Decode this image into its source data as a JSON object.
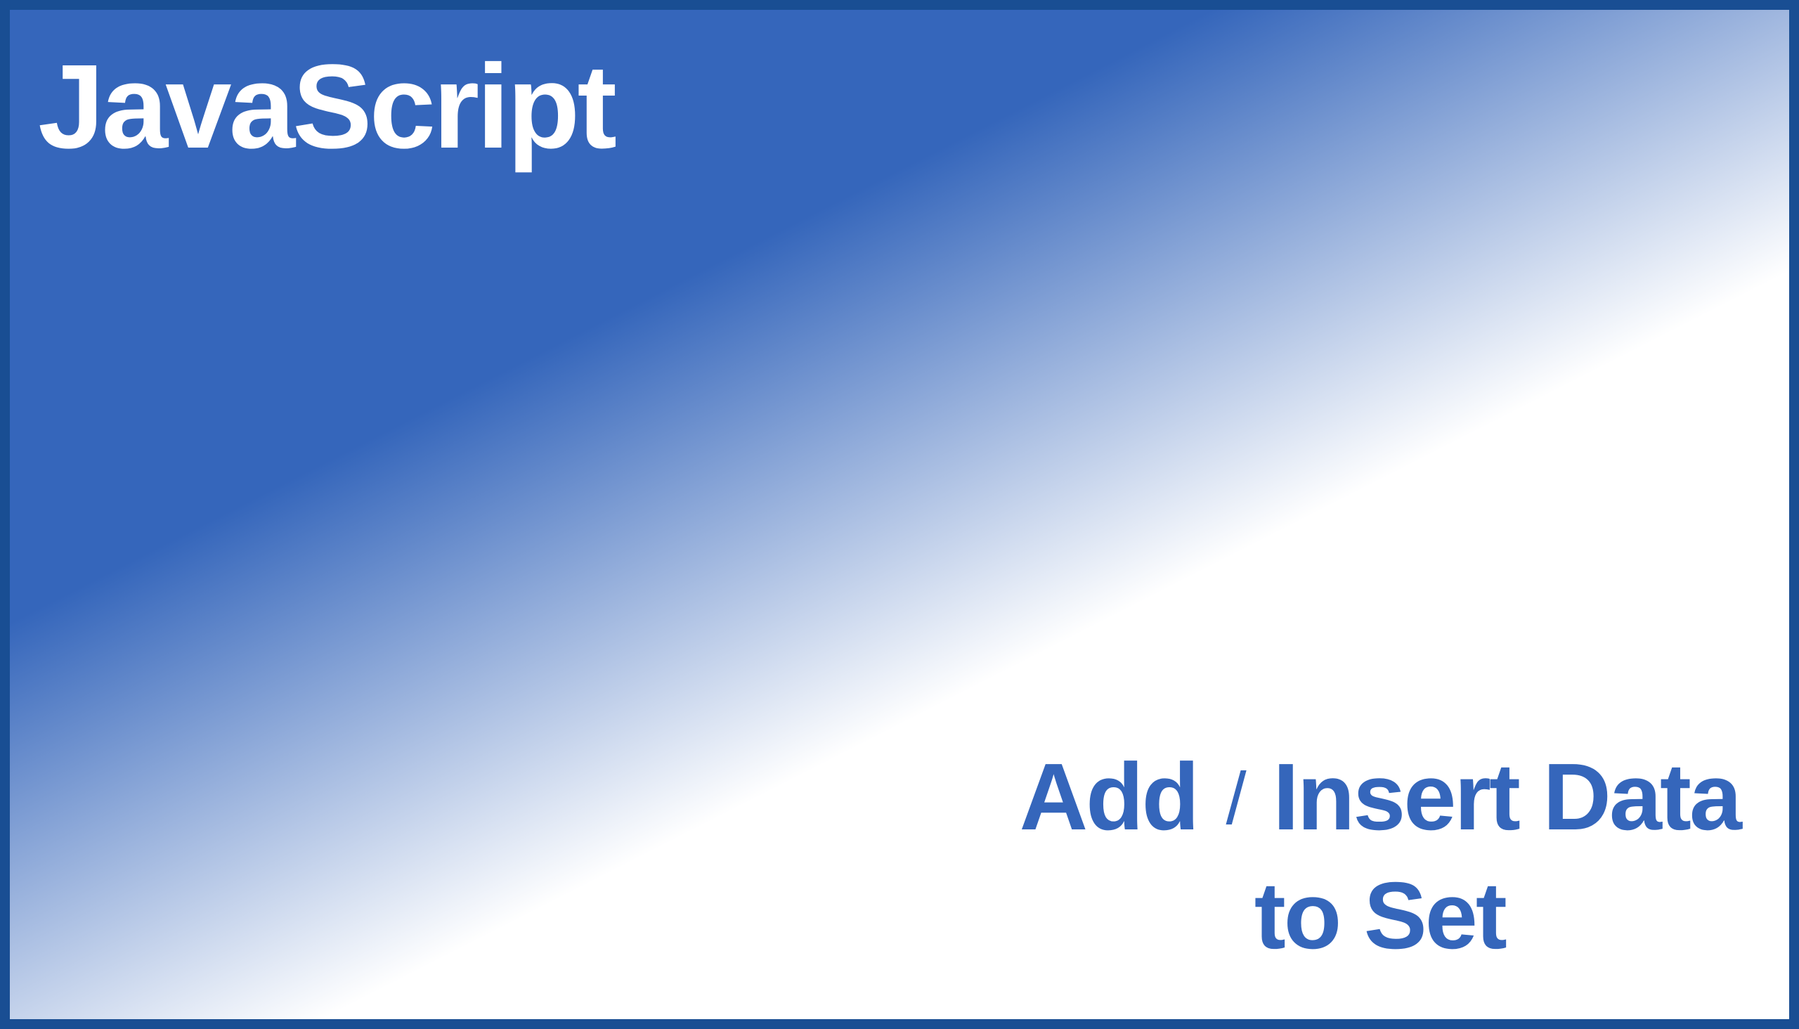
{
  "banner": {
    "title": "JavaScript",
    "subtitle_line1_a": "Add",
    "subtitle_line1_slash": "/",
    "subtitle_line1_b": "Insert Data",
    "subtitle_line2": "to Set"
  }
}
